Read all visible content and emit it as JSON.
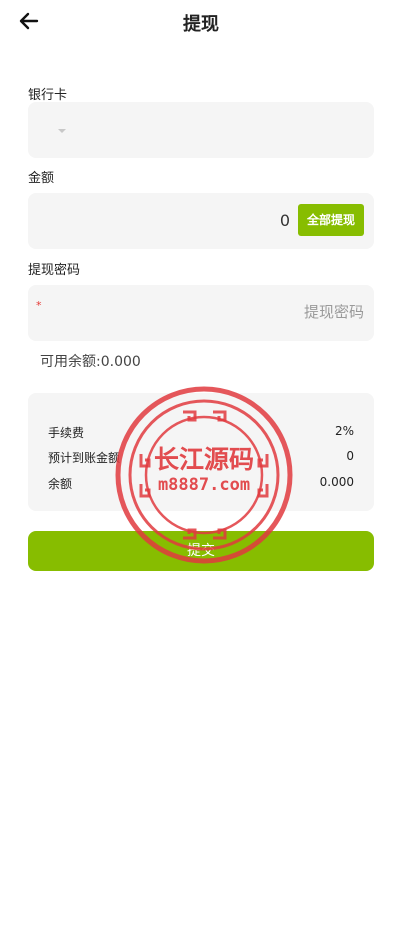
{
  "header": {
    "title": "提现"
  },
  "bank": {
    "label": "银行卡"
  },
  "amount": {
    "label": "金额",
    "value": "0",
    "all_button": "全部提现"
  },
  "password": {
    "label": "提现密码",
    "required_mark": "*",
    "placeholder": "提现密码"
  },
  "available": {
    "text": "可用余额:0.000"
  },
  "summary": {
    "rows": [
      {
        "key": "手续费",
        "value": "2%"
      },
      {
        "key": "预计到账金额",
        "value": "0"
      },
      {
        "key": "余额",
        "value": "0.000"
      }
    ]
  },
  "submit": {
    "label": "提交"
  },
  "watermark": {
    "brand": "长江源码",
    "site": "m8887.com",
    "color": "#e03a3e"
  },
  "colors": {
    "accent": "#87bd00",
    "field_bg": "#f5f5f5",
    "required": "#e53935"
  }
}
